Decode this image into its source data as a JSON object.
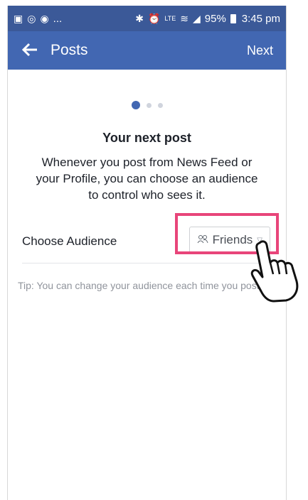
{
  "status_bar": {
    "left_icons": [
      "image-icon",
      "whatsapp-icon",
      "messenger-icon"
    ],
    "ellipsis": "...",
    "right_icons": [
      "bluetooth-icon",
      "alarm-icon",
      "volte-icon",
      "wifi-icon",
      "signal-icon"
    ],
    "battery": "95%",
    "time": "3:45 pm",
    "color": "#3b5998"
  },
  "app_bar": {
    "title": "Posts",
    "next_label": "Next",
    "color": "#4267b2"
  },
  "pager": {
    "count": 3,
    "active": 1
  },
  "content": {
    "heading": "Your next post",
    "description": "Whenever you post from News Feed or your Profile, you can choose an audience to control who sees it."
  },
  "audience": {
    "label": "Choose Audience",
    "selected": "Friends"
  },
  "tip": "Tip: You can change your audience each time you post.",
  "highlight_color": "#e8457a"
}
